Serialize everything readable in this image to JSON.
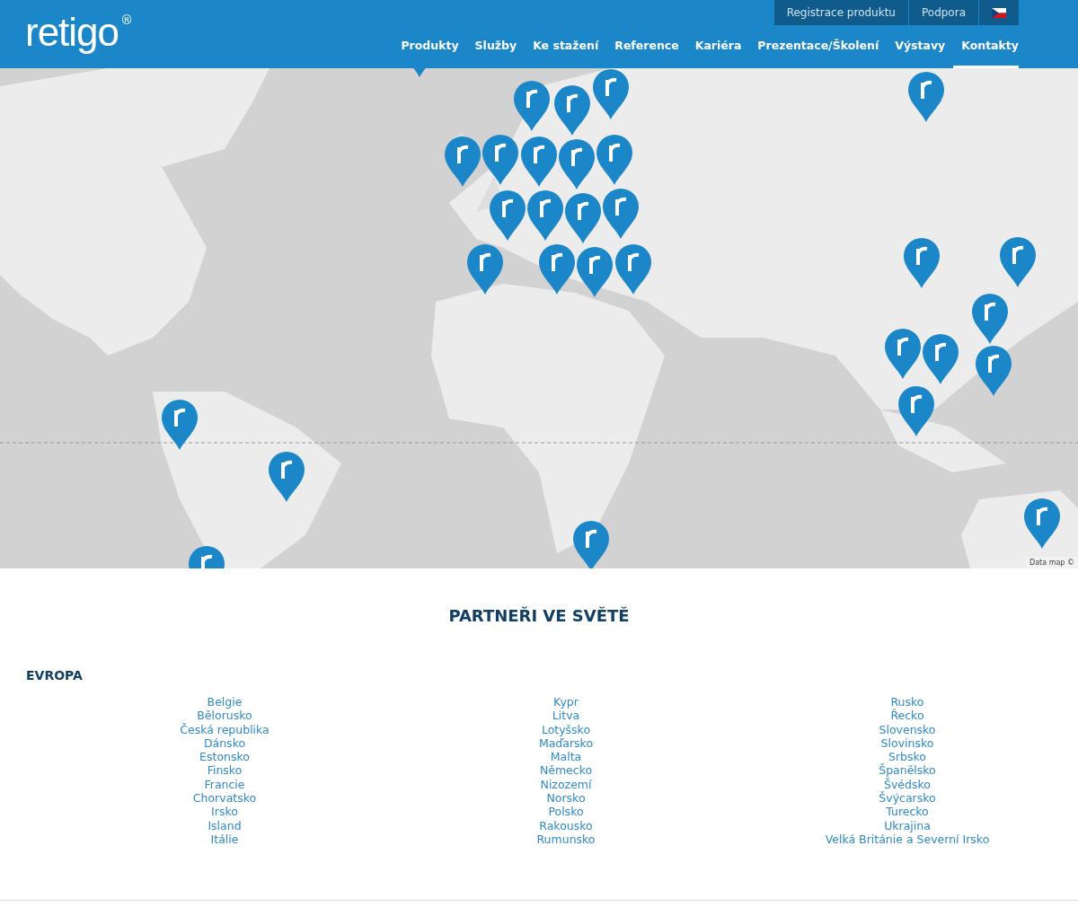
{
  "header": {
    "logo": "retigo",
    "logo_mark": "®",
    "top_links": [
      {
        "label": "Registrace produktu",
        "kind": "text"
      },
      {
        "label": "Podpora",
        "kind": "text"
      },
      {
        "kind": "flag"
      }
    ],
    "nav": [
      {
        "label": "Produkty",
        "selected": false
      },
      {
        "label": "Služby",
        "selected": false
      },
      {
        "label": "Ke stažení",
        "selected": false
      },
      {
        "label": "Reference",
        "selected": false
      },
      {
        "label": "Kariéra",
        "selected": false
      },
      {
        "label": "Prezentace/Školení",
        "selected": false
      },
      {
        "label": "Výstavy",
        "selected": false
      },
      {
        "label": "Kontakty",
        "selected": true
      }
    ]
  },
  "map": {
    "kind": "picture",
    "attribution": "Data map ©"
  },
  "section": {
    "title": "PARTNEŘI VE SVĚTĚ",
    "region": "EVROPA",
    "columns": [
      [
        "Belgie",
        "Bělorusko",
        "Česká republika",
        "Dánsko",
        "Estonsko",
        "Finsko",
        "Francie",
        "Chorvatsko",
        "Irsko",
        "Island",
        "Itálie"
      ],
      [
        "Kypr",
        "Litva",
        "Lotyšsko",
        "Maďarsko",
        "Malta",
        "Německo",
        "Nizozemí",
        "Norsko",
        "Polsko",
        "Rakousko",
        "Rumunsko"
      ],
      [
        "Rusko",
        "Řecko",
        "Slovensko",
        "Slovinsko",
        "Srbsko",
        "Španělsko",
        "Švédsko",
        "Švýcarsko",
        "Turecko",
        "Ukrajina",
        "Velká Británie a Severní Irsko"
      ]
    ]
  }
}
